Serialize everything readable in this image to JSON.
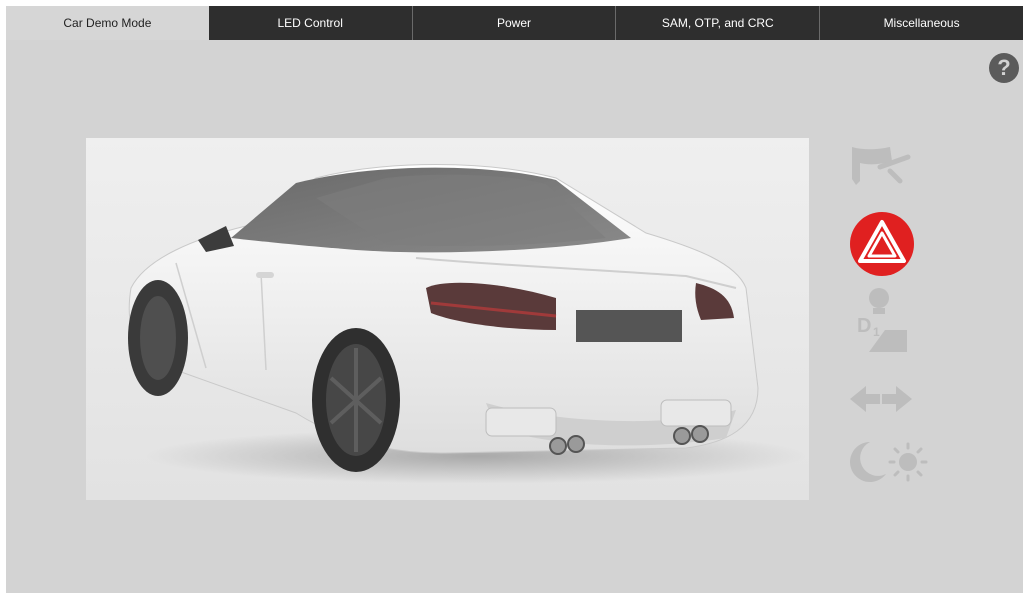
{
  "tabs": [
    {
      "label": "Car Demo Mode",
      "active": true
    },
    {
      "label": "LED Control",
      "active": false
    },
    {
      "label": "Power",
      "active": false
    },
    {
      "label": "SAM, OTP, and CRC",
      "active": false
    },
    {
      "label": "Miscellaneous",
      "active": false
    }
  ],
  "help": {
    "icon": "question-circle-icon",
    "glyph": "?"
  },
  "car_image": {
    "subject": "white coupe car, rear three-quarter view"
  },
  "controls": [
    {
      "name": "wiper-icon",
      "active": false
    },
    {
      "name": "hazard-warning-icon",
      "active": true
    },
    {
      "name": "headlight-gear-icon",
      "active": false
    },
    {
      "name": "turn-signal-arrows-icon",
      "active": false
    },
    {
      "name": "day-night-icon",
      "active": false
    }
  ],
  "colors": {
    "background": "#d3d3d3",
    "tab_bar": "#2e2e2e",
    "tab_active": "#d6d6d6",
    "hazard_red": "#e02020",
    "inactive_icon": "#bdbdbd",
    "help_icon": "#5b5b5b"
  }
}
